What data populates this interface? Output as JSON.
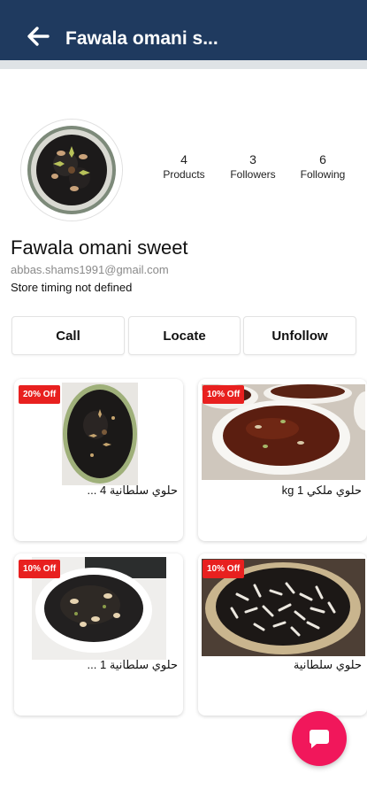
{
  "header": {
    "title": "Fawala omani s...",
    "back_icon": "arrow-left-icon",
    "bg_color": "#1f3a5f"
  },
  "profile": {
    "stats": [
      {
        "value": "4",
        "label": "Products"
      },
      {
        "value": "3",
        "label": "Followers"
      },
      {
        "value": "6",
        "label": "Following"
      }
    ],
    "name": "Fawala omani sweet",
    "email": "abbas.shams1991@gmail.com",
    "timing": "Store timing not defined"
  },
  "actions": {
    "call": "Call",
    "locate": "Locate",
    "unfollow": "Unfollow"
  },
  "products": [
    {
      "badge": "20% Off",
      "name": "حلوي سلطانية 4 ..."
    },
    {
      "badge": "10% Off",
      "name": "حلوي ملكي 1 kg"
    },
    {
      "badge": "10% Off",
      "name": "حلوي سلطانية 1 ..."
    },
    {
      "badge": "10% Off",
      "name": "حلوي سلطانية"
    }
  ],
  "fab": {
    "icon": "chat-bubble-icon",
    "color": "#f1175b"
  },
  "colors": {
    "badge": "#e8201f"
  }
}
